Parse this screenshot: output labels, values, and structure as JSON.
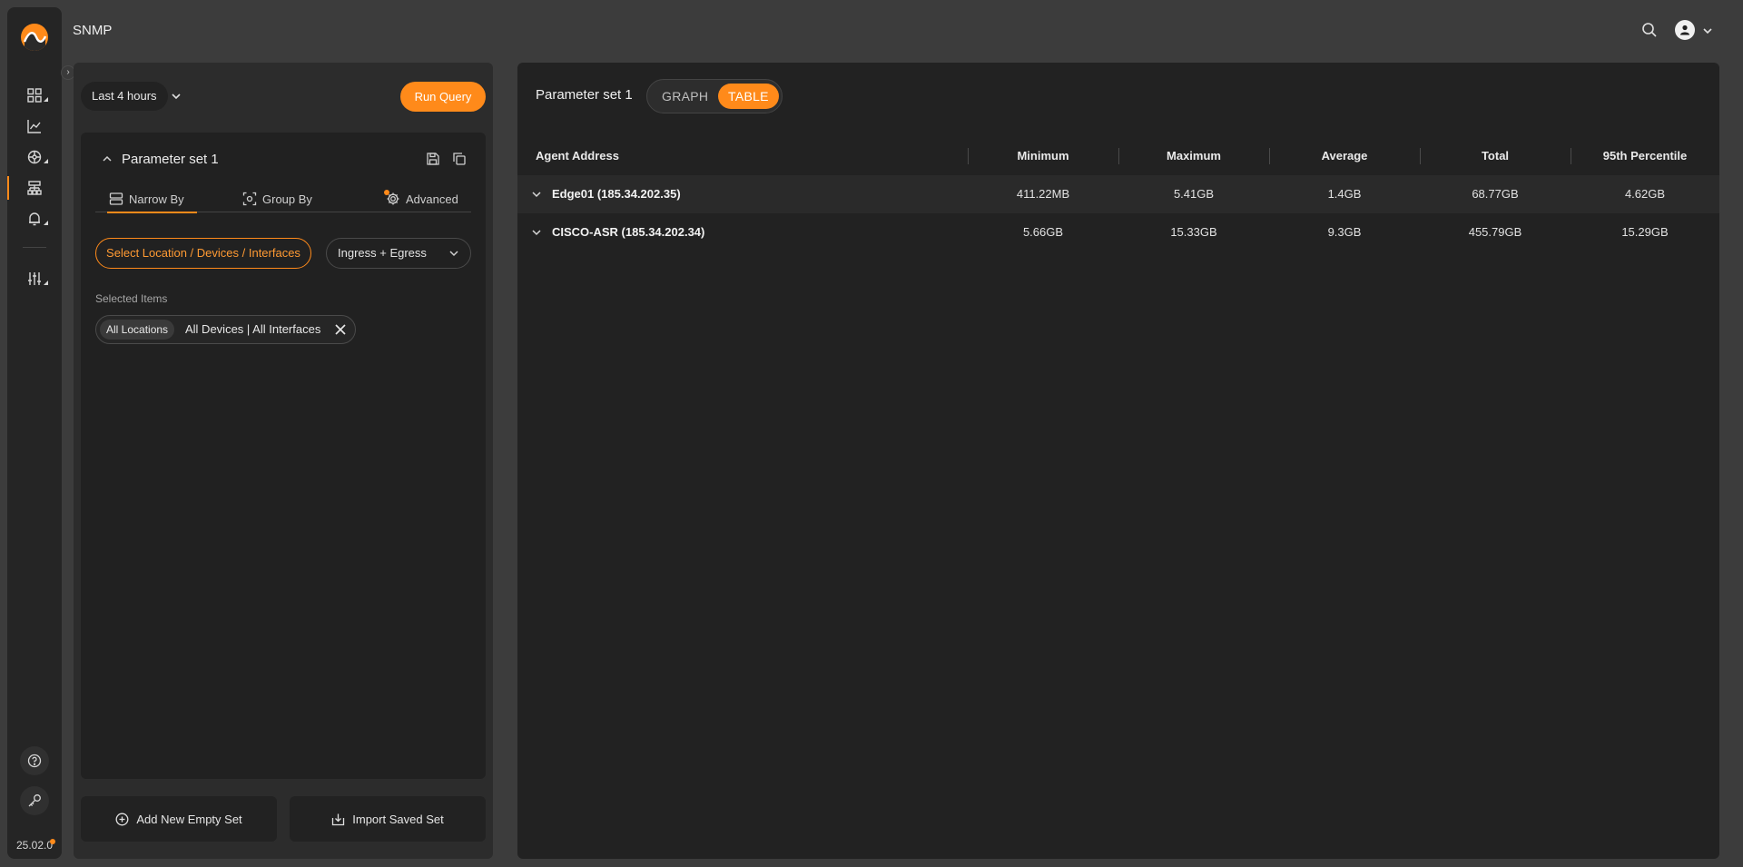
{
  "app": {
    "title": "SNMP",
    "version": "25.02.0"
  },
  "sidebar": {
    "items": [
      {
        "name": "dashboard"
      },
      {
        "name": "analytics"
      },
      {
        "name": "network"
      },
      {
        "name": "snmp"
      },
      {
        "name": "alerts"
      },
      {
        "name": "settings"
      }
    ]
  },
  "query": {
    "time_range": "Last 4 hours",
    "run_label": "Run Query"
  },
  "parameter_set": {
    "title": "Parameter set 1",
    "tabs": [
      "Narrow By",
      "Group By",
      "Advanced"
    ],
    "select_button": "Select Location / Devices / Interfaces",
    "direction": "Ingress + Egress",
    "selected_items_label": "Selected Items",
    "chip": {
      "location": "All Locations",
      "detail": "All Devices | All Interfaces"
    }
  },
  "footer_buttons": {
    "add_new": "Add New Empty Set",
    "import_saved": "Import Saved Set"
  },
  "results": {
    "title": "Parameter set 1",
    "view_options": [
      "GRAPH",
      "TABLE"
    ],
    "active_view": "TABLE",
    "columns": [
      "Agent Address",
      "Minimum",
      "Maximum",
      "Average",
      "Total",
      "95th Percentile"
    ],
    "rows": [
      {
        "agent": "Edge01 (185.34.202.35)",
        "minimum": "411.22MB",
        "maximum": "5.41GB",
        "average": "1.4GB",
        "total": "68.77GB",
        "p95": "4.62GB"
      },
      {
        "agent": "CISCO-ASR (185.34.202.34)",
        "minimum": "5.66GB",
        "maximum": "15.33GB",
        "average": "9.3GB",
        "total": "455.79GB",
        "p95": "15.29GB"
      }
    ]
  },
  "colors": {
    "accent": "#ff8a1a",
    "background": "#3c3c3c",
    "panel": "#2c2c2c",
    "surface": "#222222"
  }
}
